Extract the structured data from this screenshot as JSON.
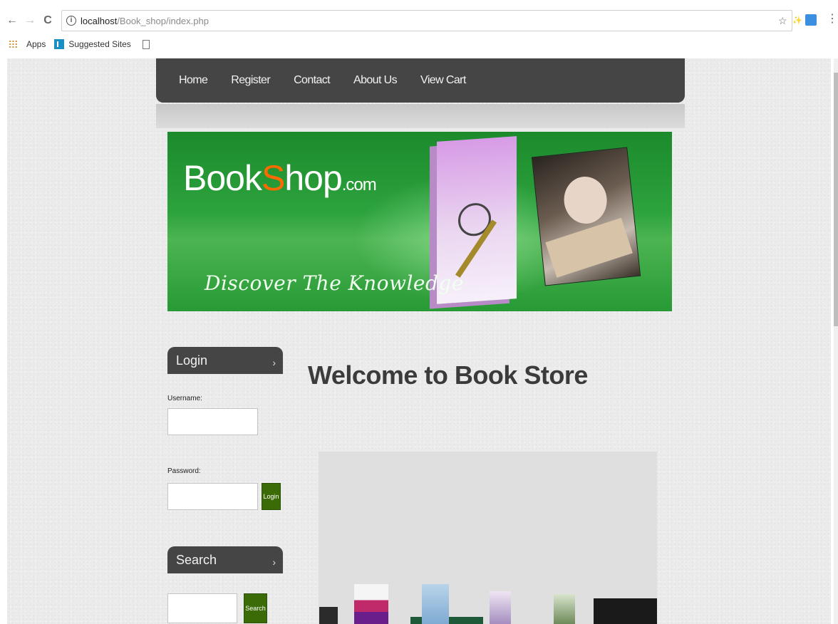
{
  "browser": {
    "nav_back": "←",
    "nav_forward": "→",
    "nav_reload": "C",
    "url_info_glyph": "i",
    "url_host": "localhost",
    "url_path": "/Book_shop/index.php",
    "star_glyph": "☆",
    "extension_glyph": "✨",
    "menu_glyph": "⋮",
    "bookmarks": {
      "apps": "Apps",
      "suggested_sites": "Suggested Sites"
    }
  },
  "site": {
    "nav": [
      "Home",
      "Register",
      "Contact",
      "About Us",
      "View Cart"
    ],
    "banner": {
      "logo_part1": "Book",
      "logo_accent": "S",
      "logo_part2": "hop",
      "logo_tld": ".com",
      "tagline": "Discover The Knowledge"
    },
    "login": {
      "title": "Login",
      "chevron": "›",
      "username_label": "Username:",
      "password_label": "Password:",
      "button": "Login"
    },
    "search": {
      "title": "Search",
      "chevron": "›",
      "button": "Search"
    },
    "welcome": "Welcome to Book Store"
  },
  "colors": {
    "nav_bg": "#454545",
    "banner_green": "#2da33d",
    "logo_accent": "#ff6a00",
    "button_green": "#3a6b06"
  }
}
